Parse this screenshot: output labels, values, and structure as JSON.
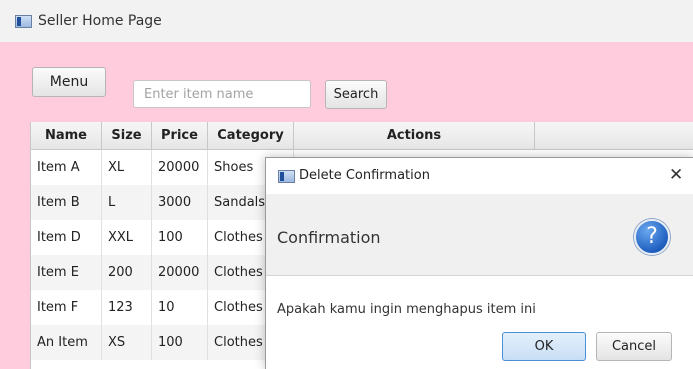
{
  "window": {
    "title": "Seller Home Page"
  },
  "toolbar": {
    "menu_label": "Menu",
    "search_placeholder": "Enter item name",
    "search_value": "",
    "search_label": "Search"
  },
  "table": {
    "columns": [
      "Name",
      "Size",
      "Price",
      "Category",
      "Actions"
    ],
    "rows": [
      [
        "Item A",
        "XL",
        "20000",
        "Shoes"
      ],
      [
        "Item B",
        "L",
        "3000",
        "Sandals"
      ],
      [
        "Item D",
        "XXL",
        "100",
        "Clothes"
      ],
      [
        "Item E",
        "200",
        "20000",
        "Clothes"
      ],
      [
        "Item F",
        "123",
        "10",
        "Clothes"
      ],
      [
        "An Item",
        "XS",
        "100",
        "Clothes"
      ]
    ]
  },
  "dialog": {
    "title": "Delete Confirmation",
    "close_glyph": "✕",
    "header": "Confirmation",
    "help_glyph": "?",
    "content": "Apakah kamu ingin menghapus item ini",
    "ok_label": "OK",
    "cancel_label": "Cancel"
  }
}
